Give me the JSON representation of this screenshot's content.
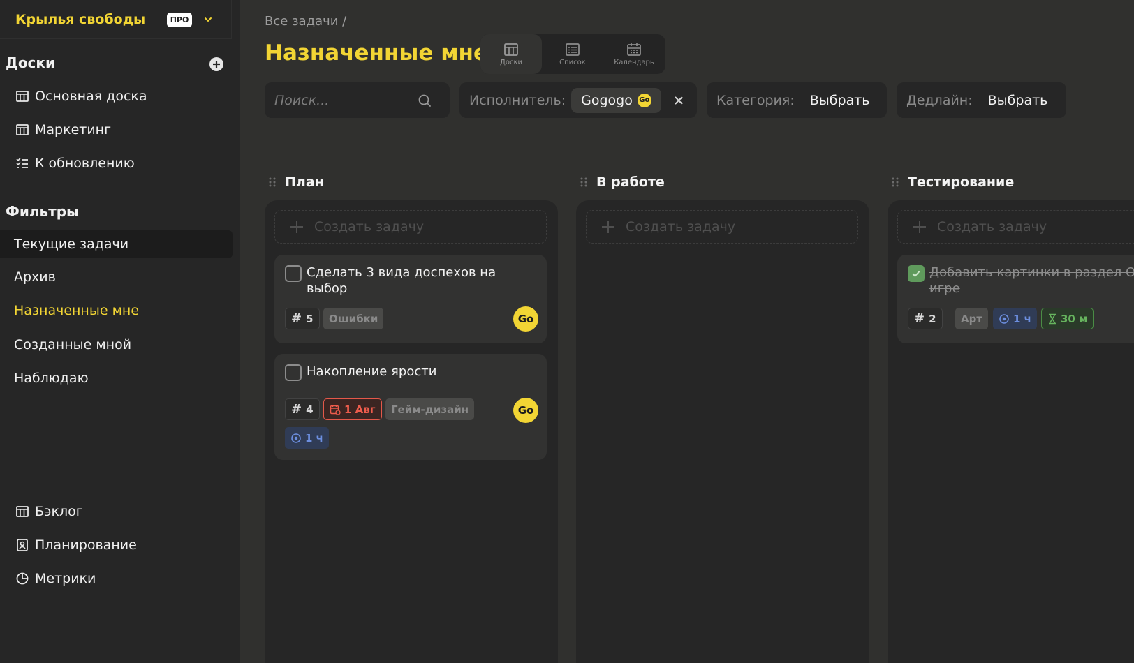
{
  "workspace": {
    "name": "Крылья свободы",
    "plan_badge": "ПРО"
  },
  "sidebar": {
    "boards_title": "Доски",
    "boards": [
      {
        "label": "Основная доска",
        "icon": "board-icon"
      },
      {
        "label": "Маркетинг",
        "icon": "board-icon"
      },
      {
        "label": "К обновлению",
        "icon": "checklist-icon"
      }
    ],
    "filters_title": "Фильтры",
    "filters": [
      {
        "label": "Текущие задачи"
      },
      {
        "label": "Архив"
      },
      {
        "label": "Назначенные мне"
      },
      {
        "label": "Созданные мной"
      },
      {
        "label": "Наблюдаю"
      }
    ],
    "bottom": [
      {
        "label": "Бэклог",
        "icon": "board-icon"
      },
      {
        "label": "Планирование",
        "icon": "planning-icon"
      },
      {
        "label": "Метрики",
        "icon": "pie-chart-icon"
      }
    ]
  },
  "header": {
    "breadcrumb": "Все задачи /",
    "title": "Назначенные мне",
    "views": [
      {
        "label": "Доски",
        "active": true
      },
      {
        "label": "Список",
        "active": false
      },
      {
        "label": "Календарь",
        "active": false
      }
    ]
  },
  "filters": {
    "search_placeholder": "Поиск...",
    "assignee_label": "Исполнитель:",
    "assignee_value": "Gogogo",
    "assignee_avatar": "Go",
    "category_label": "Категория:",
    "category_value": "Выбрать",
    "deadline_label": "Дедлайн:",
    "deadline_value": "Выбрать"
  },
  "columns": [
    {
      "title": "План",
      "create_label": "Создать задачу",
      "cards": [
        {
          "title": "Сделать 3 вида доспехов на выбор",
          "number": "5",
          "category": "Ошибки",
          "avatar": "Go",
          "done": false
        },
        {
          "title": "Накопление ярости",
          "number": "4",
          "date": "1 Авг",
          "category": "Гейм-дизайн",
          "estimate": "1 ч",
          "avatar": "Go",
          "done": false
        }
      ]
    },
    {
      "title": "В работе",
      "create_label": "Создать задачу",
      "cards": []
    },
    {
      "title": "Тестирование",
      "create_label": "Создать задачу",
      "cards": [
        {
          "title_line1": "Добавить картинки в раздел Об",
          "title_line2": "игре",
          "number": "2",
          "category": "Арт",
          "estimate": "1 ч",
          "timer": "30 м",
          "done": true
        }
      ]
    }
  ],
  "colors": {
    "accent": "#f2d534",
    "background": "#30302e",
    "sidebar": "#262626",
    "danger": "#ee5c4c",
    "success": "#5f9a5c"
  }
}
